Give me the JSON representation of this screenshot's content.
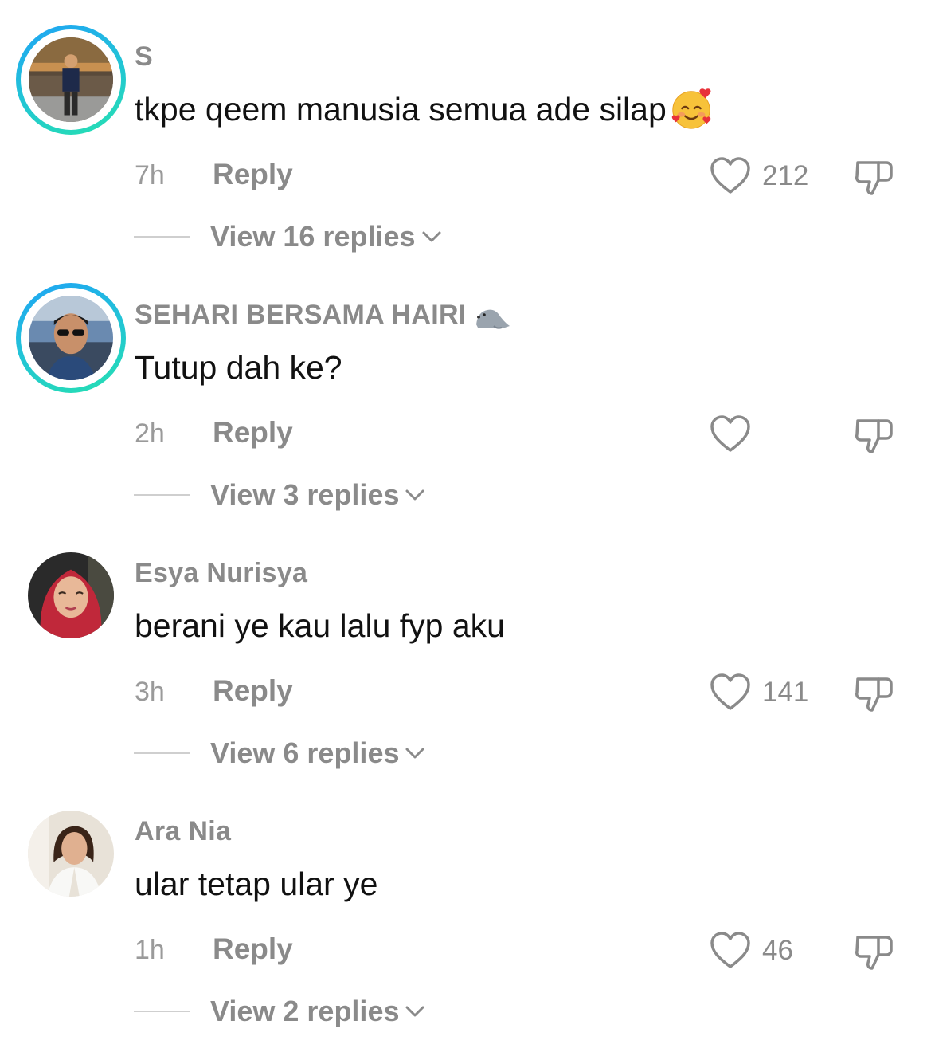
{
  "comments": [
    {
      "username": "S",
      "username_emoji": "",
      "text": "tkpe qeem manusia semua ade silap",
      "text_emoji": "smiling-face-with-hearts",
      "time": "7h",
      "reply_label": "Reply",
      "likes": "212",
      "view_replies": "View 16 replies",
      "avatar_ring": true
    },
    {
      "username": "SEHARI BERSAMA HAIRI",
      "username_emoji": "seal",
      "text": "Tutup dah ke?",
      "text_emoji": "",
      "time": "2h",
      "reply_label": "Reply",
      "likes": "",
      "view_replies": "View 3 replies",
      "avatar_ring": true
    },
    {
      "username": "Esya Nurisya",
      "username_emoji": "",
      "text": "berani ye kau lalu fyp aku",
      "text_emoji": "",
      "time": "3h",
      "reply_label": "Reply",
      "likes": "141",
      "view_replies": "View 6 replies",
      "avatar_ring": false
    },
    {
      "username": "Ara Nia",
      "username_emoji": "",
      "text": "ular tetap ular ye",
      "text_emoji": "",
      "time": "1h",
      "reply_label": "Reply",
      "likes": "46",
      "view_replies": "View 2 replies",
      "avatar_ring": false
    }
  ],
  "icons": {
    "like": "heart-outline-icon",
    "dislike": "thumbs-down-icon",
    "expand": "chevron-down-icon"
  },
  "colors": {
    "username": "#8a8a8a",
    "text": "#111111",
    "meta": "#9a9a9a",
    "ring_start": "#1fa3f5",
    "ring_end": "#26e0b0"
  }
}
